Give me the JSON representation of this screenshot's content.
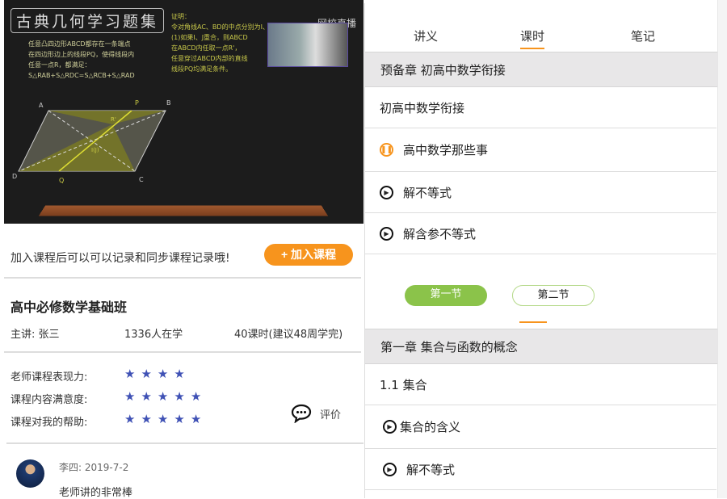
{
  "video": {
    "title": "古典几何学习题集",
    "problem": [
      "任意凸四边形ABCD都存在一条端点",
      "在四边形边上的线段PQ，使得线段内",
      "任意一点R，都满足：",
      "S△RAB+S△RDC=S△RCB+S△RAD"
    ],
    "proof": [
      "证明：",
      "令对角线AC、BD的中点分别为I、J",
      "(1)如果I、J重合，则ABCD",
      "在ABCD内任取一点R'，",
      "任意穿过ABCD内部的直线",
      "线段PQ均满足条件。"
    ],
    "points": [
      "A",
      "B",
      "C",
      "D",
      "P",
      "Q",
      "R'",
      "I(J)"
    ],
    "logo": "网校直播"
  },
  "promo": {
    "text": "加入课程后可以可以记录和同步课程记录哦!",
    "join_label": "+ 加入课程",
    "accent": "#f7941d"
  },
  "course": {
    "title": "高中必修数学基础班",
    "teacher": "主讲: 张三",
    "students": "1336人在学",
    "lessons": "40课时(建议48周学完)"
  },
  "ratings": [
    {
      "label": "老师课程表现力:",
      "stars": 4
    },
    {
      "label": "课程内容满意度:",
      "stars": 5
    },
    {
      "label": "课程对我的帮助:",
      "stars": 5
    }
  ],
  "star_color": "#3f51b5",
  "comment_label": "评价",
  "review": {
    "author": "李四: 2019-7-2",
    "text": "老师讲的非常棒"
  },
  "tabs": [
    {
      "label": "讲义"
    },
    {
      "label": "课时",
      "active": true
    },
    {
      "label": "笔记"
    }
  ],
  "chapter0": {
    "title": "预备章  初高中数学衔接",
    "section": "初高中数学衔接",
    "items": [
      {
        "label": "高中数学那些事",
        "state": "playing"
      },
      {
        "label": "解不等式",
        "state": "play"
      },
      {
        "label": "解含参不等式",
        "state": "play"
      }
    ]
  },
  "sections": [
    {
      "label": "第一节",
      "active": true,
      "color": "#8bc34a"
    },
    {
      "label": "第二节"
    }
  ],
  "chapter1": {
    "title": "第一章  集合与函数的概念",
    "section": "1.1  集合",
    "items": [
      {
        "label": "集合的含义",
        "state": "play"
      },
      {
        "label": "解不等式",
        "state": "play"
      }
    ]
  }
}
